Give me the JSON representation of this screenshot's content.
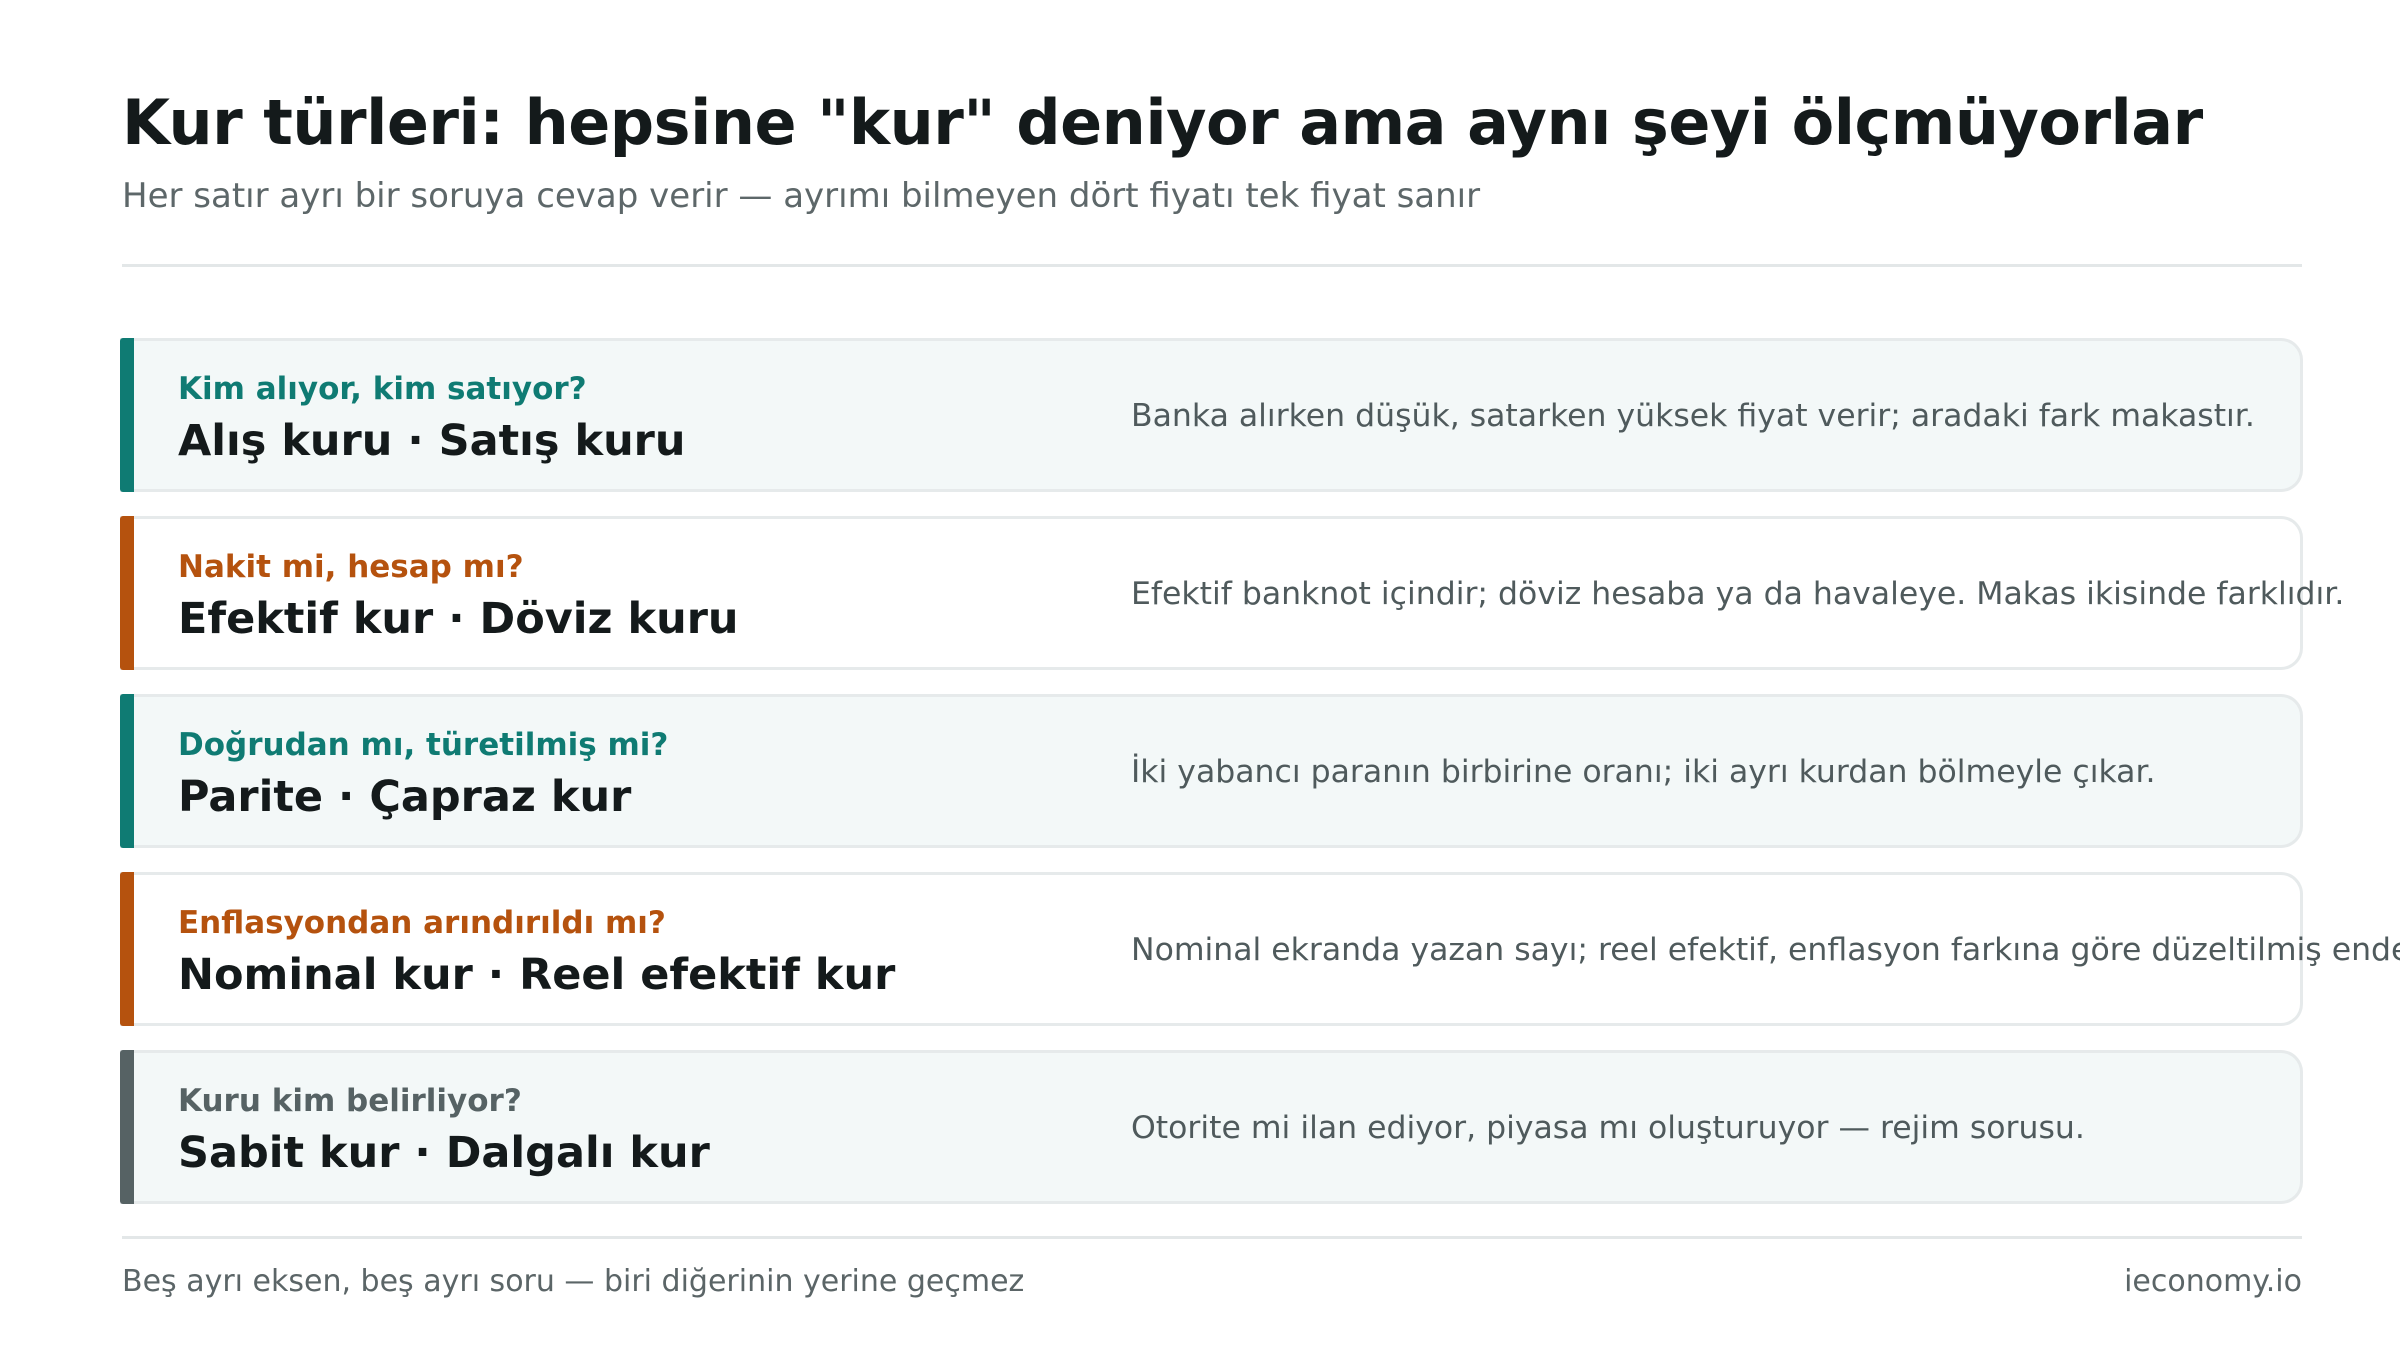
{
  "title": "Kur türleri: hepsine \"kur\" deniyor ama aynı şeyi ölçmüyorlar",
  "subtitle": "Her satır ayrı bir soruya cevap verir — ayrımı bilmeyen dört fiyatı tek fiyat sanır",
  "rows": [
    {
      "question": "Kim alıyor, kim satıyor?",
      "term": "Alış kuru · Satış kuru",
      "description": "Banka alırken düşük, satarken yüksek fiyat verir; aradaki fark makastır.",
      "accent_color": "#0f7b73",
      "question_color": "#0f7b73"
    },
    {
      "question": "Nakit mi, hesap mı?",
      "term": "Efektif kur · Döviz kuru",
      "description": "Efektif banknot içindir; döviz hesaba ya da havaleye. Makas ikisinde farklıdır.",
      "accent_color": "#b5520e",
      "question_color": "#b5520e"
    },
    {
      "question": "Doğrudan mı, türetilmiş mi?",
      "term": "Parite · Çapraz kur",
      "description": "İki yabancı paranın birbirine oranı; iki ayrı kurdan bölmeyle çıkar.",
      "accent_color": "#0f7b73",
      "question_color": "#0f7b73"
    },
    {
      "question": "Enflasyondan arındırıldı mı?",
      "term": "Nominal kur · Reel efektif kur",
      "description": "Nominal ekranda yazan sayı; reel efektif, enflasyon farkına göre düzeltilmiş endeks.",
      "accent_color": "#b5520e",
      "question_color": "#b5520e"
    },
    {
      "question": "Kuru kim belirliyor?",
      "term": "Sabit kur · Dalgalı kur",
      "description": "Otorite mi ilan ediyor, piyasa mı oluşturuyor — rejim sorusu.",
      "accent_color": "#566264",
      "question_color": "#566264"
    }
  ],
  "footer": {
    "note": "Beş ayrı eksen, beş ayrı soru — biri diğerinin yerine geçmez",
    "brand": "ieconomy.io"
  }
}
